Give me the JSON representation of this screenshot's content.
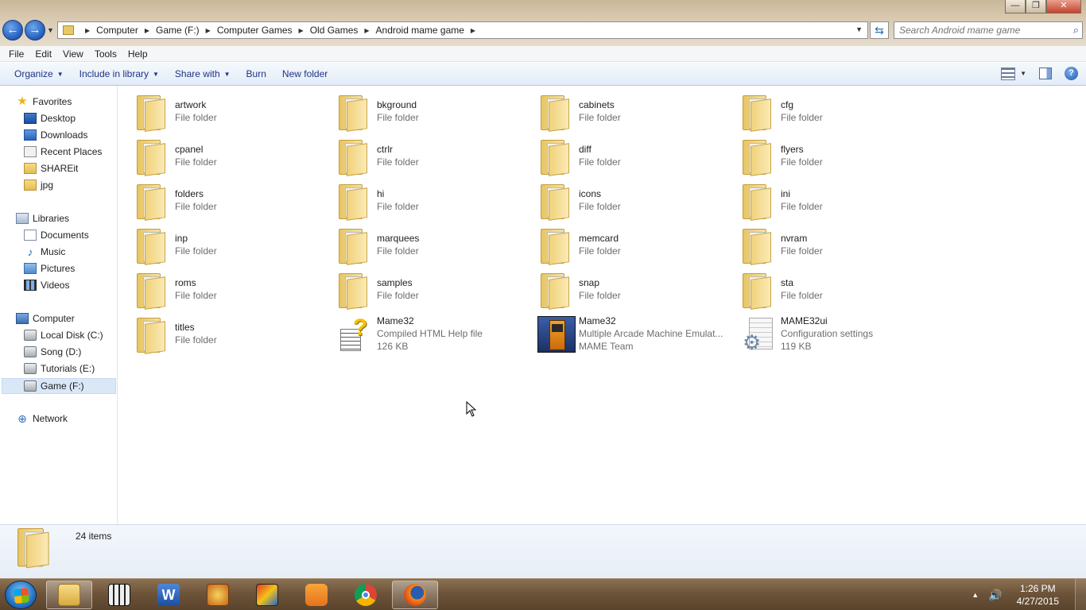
{
  "window": {
    "controls": {
      "minimize": "—",
      "maximize": "❐",
      "close": "✕"
    }
  },
  "address": {
    "crumbs": [
      "Computer",
      "Game (F:)",
      "Computer Games",
      "Old Games",
      "Android mame game"
    ],
    "search_placeholder": "Search Android mame game"
  },
  "menu": [
    "File",
    "Edit",
    "View",
    "Tools",
    "Help"
  ],
  "commands": {
    "organize": "Organize",
    "include_in_library": "Include in library",
    "share_with": "Share with",
    "burn": "Burn",
    "new_folder": "New folder"
  },
  "nav": {
    "favorites": {
      "label": "Favorites",
      "items": [
        "Desktop",
        "Downloads",
        "Recent Places",
        "SHAREit",
        "jpg"
      ]
    },
    "libraries": {
      "label": "Libraries",
      "items": [
        "Documents",
        "Music",
        "Pictures",
        "Videos"
      ]
    },
    "computer": {
      "label": "Computer",
      "items": [
        "Local Disk (C:)",
        "Song (D:)",
        "Tutorials (E:)",
        "Game (F:)"
      ]
    },
    "network": {
      "label": "Network"
    }
  },
  "files": [
    {
      "name": "artwork",
      "type": "File folder"
    },
    {
      "name": "bkground",
      "type": "File folder"
    },
    {
      "name": "cabinets",
      "type": "File folder"
    },
    {
      "name": "cfg",
      "type": "File folder"
    },
    {
      "name": "cpanel",
      "type": "File folder"
    },
    {
      "name": "ctrlr",
      "type": "File folder"
    },
    {
      "name": "diff",
      "type": "File folder"
    },
    {
      "name": "flyers",
      "type": "File folder"
    },
    {
      "name": "folders",
      "type": "File folder"
    },
    {
      "name": "hi",
      "type": "File folder"
    },
    {
      "name": "icons",
      "type": "File folder"
    },
    {
      "name": "ini",
      "type": "File folder"
    },
    {
      "name": "inp",
      "type": "File folder"
    },
    {
      "name": "marquees",
      "type": "File folder"
    },
    {
      "name": "memcard",
      "type": "File folder"
    },
    {
      "name": "nvram",
      "type": "File folder"
    },
    {
      "name": "roms",
      "type": "File folder"
    },
    {
      "name": "samples",
      "type": "File folder"
    },
    {
      "name": "snap",
      "type": "File folder"
    },
    {
      "name": "sta",
      "type": "File folder"
    },
    {
      "name": "titles",
      "type": "File folder"
    },
    {
      "name": "Mame32",
      "type": "Compiled HTML Help file",
      "size": "126 KB",
      "icon": "chm-help-icon"
    },
    {
      "name": "Mame32",
      "type": "Multiple Arcade Machine Emulat...",
      "size": "MAME Team",
      "icon": "mame-app-icon"
    },
    {
      "name": "MAME32ui",
      "type": "Configuration settings",
      "size": "119 KB",
      "icon": "config-settings-icon"
    }
  ],
  "status": {
    "count": "24 items"
  },
  "taskbar": {
    "apps": [
      "windows-explorer",
      "file-manager",
      "microsoft-word",
      "media-app",
      "neo-race-game",
      "uc-browser",
      "google-chrome",
      "firefox"
    ],
    "time": "1:26 PM",
    "date": "4/27/2015"
  }
}
